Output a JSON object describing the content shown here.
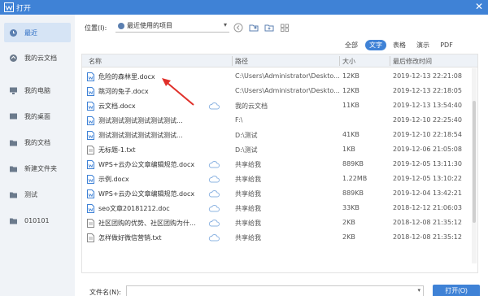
{
  "window": {
    "title": "打开",
    "close_glyph": "✕"
  },
  "sidebar": {
    "items": [
      {
        "label": "最近",
        "icon": "clock-icon",
        "active": true
      },
      {
        "label": "我的云文档",
        "icon": "cloud-doc-icon",
        "active": false
      },
      {
        "label": "我的电脑",
        "icon": "computer-icon",
        "active": false
      },
      {
        "label": "我的桌面",
        "icon": "desktop-icon",
        "active": false
      },
      {
        "label": "我的文档",
        "icon": "documents-folder-icon",
        "active": false
      },
      {
        "label": "新建文件夹",
        "icon": "folder-icon",
        "active": false
      },
      {
        "label": "测试",
        "icon": "folder-icon",
        "active": false
      },
      {
        "label": "010101",
        "icon": "folder-icon",
        "active": false
      }
    ]
  },
  "location": {
    "label": "位置(I):",
    "value": "最近使用的项目",
    "arrow": "▾"
  },
  "filters": [
    "全部",
    "文字",
    "表格",
    "演示",
    "PDF"
  ],
  "filter_active": "文字",
  "table": {
    "headers": {
      "name": "名称",
      "path": "路径",
      "size": "大小",
      "time": "最后修改时间"
    },
    "rows": [
      {
        "name": "危险的森林里.docx",
        "path": "C:\\Users\\Administrator\\Deskto...",
        "size": "12KB",
        "time": "2019-12-13 22:21:08",
        "type": "doc",
        "cloud": false
      },
      {
        "name": "跳河的兔子.docx",
        "path": "C:\\Users\\Administrator\\Deskto...",
        "size": "12KB",
        "time": "2019-12-13 22:18:05",
        "type": "doc",
        "cloud": false
      },
      {
        "name": "云文档.docx",
        "path": "我的云文档",
        "size": "11KB",
        "time": "2019-12-13 13:54:40",
        "type": "doc",
        "cloud": true
      },
      {
        "name": "测试测试测试测试测试测试...",
        "path": "F:\\",
        "size": "",
        "time": "2019-12-10 22:25:40",
        "type": "doc",
        "cloud": false
      },
      {
        "name": "测试测试测试测试测试测试...",
        "path": "D:\\测试",
        "size": "41KB",
        "time": "2019-12-10 22:18:54",
        "type": "doc",
        "cloud": false
      },
      {
        "name": "无标题-1.txt",
        "path": "D:\\测试",
        "size": "1KB",
        "time": "2019-12-06 21:05:08",
        "type": "txt",
        "cloud": false
      },
      {
        "name": "WPS+云办公文章编辑规范.docx",
        "path": "共享给我",
        "size": "889KB",
        "time": "2019-12-05 13:11:30",
        "type": "doc",
        "cloud": true
      },
      {
        "name": "示例.docx",
        "path": "共享给我",
        "size": "1.22MB",
        "time": "2019-12-05 13:10:22",
        "type": "doc",
        "cloud": true
      },
      {
        "name": "WPS+云办公文章编辑规范.docx",
        "path": "共享给我",
        "size": "889KB",
        "time": "2019-12-04 13:42:21",
        "type": "doc",
        "cloud": true
      },
      {
        "name": "seo文章20181212.doc",
        "path": "共享给我",
        "size": "33KB",
        "time": "2018-12-12 21:06:03",
        "type": "doc",
        "cloud": true
      },
      {
        "name": "社区团购的优势、社区团购为什...",
        "path": "共享给我",
        "size": "2KB",
        "time": "2018-12-08 21:35:12",
        "type": "txt",
        "cloud": true
      },
      {
        "name": "怎样做好微信营销.txt",
        "path": "共享给我",
        "size": "2KB",
        "time": "2018-12-08 21:35:12",
        "type": "txt",
        "cloud": true
      }
    ]
  },
  "bottom": {
    "filename_label": "文件名(N):",
    "open_label": "打开(O)",
    "open_arrow": "▾",
    "filename_value": ""
  },
  "colors": {
    "accent": "#3f82d6",
    "annotation_arrow": "#e0302a"
  }
}
